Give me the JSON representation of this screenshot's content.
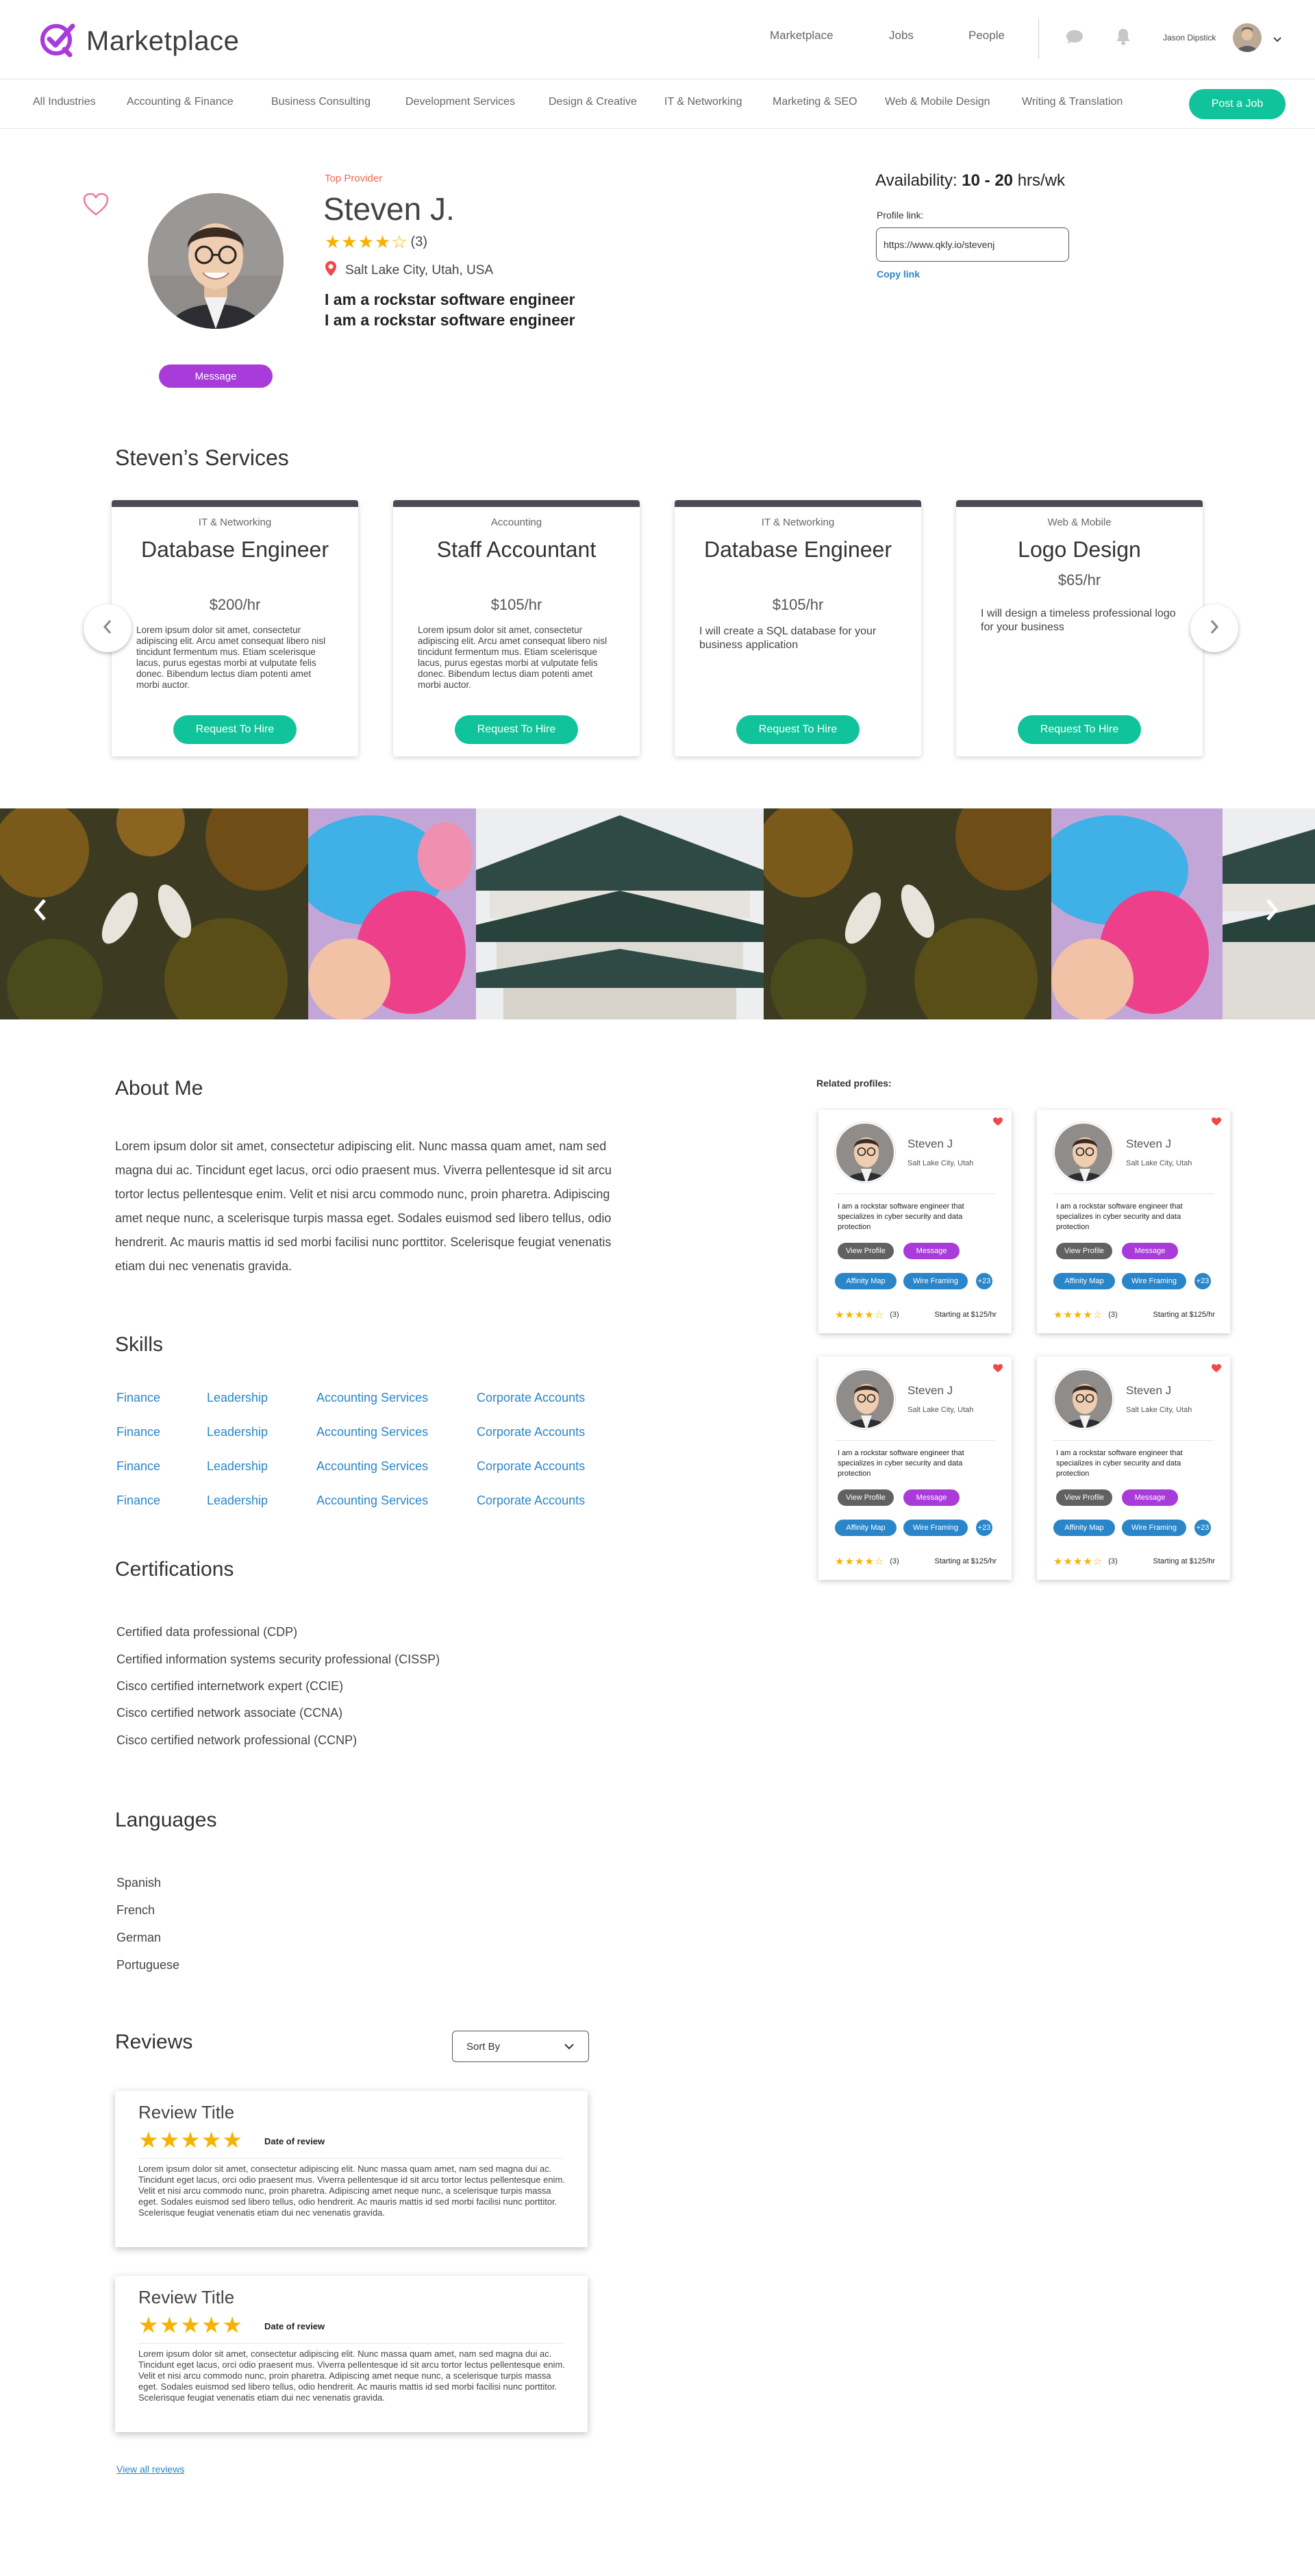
{
  "header": {
    "logo_text": "Marketplace",
    "nav": [
      "Marketplace",
      "Jobs",
      "People"
    ],
    "user_name": "Jason Dipstick"
  },
  "categories": [
    "All Industries",
    "Accounting & Finance",
    "Business Consulting",
    "Development Services",
    "Design & Creative",
    "IT & Networking",
    "Marketing & SEO",
    "Web & Mobile Design",
    "Writing & Translation"
  ],
  "post_job_label": "Post a Job",
  "profile": {
    "badge": "Top Provider",
    "name": "Steven J.",
    "stars": "★★★★☆",
    "rating_count": "(3)",
    "location": "Salt Lake City, Utah, USA",
    "tagline_1": "I am a rockstar software engineer",
    "tagline_2": "I am a rockstar software engineer",
    "message_label": "Message",
    "availability_label": "Availability:",
    "availability_range": "10 - 20",
    "availability_unit": "hrs/wk",
    "profile_link_label": "Profile link:",
    "profile_link_value": "https://www.qkly.io/stevenj",
    "copy_link_label": "Copy link"
  },
  "services": {
    "heading": "Steven’s Services",
    "cards": [
      {
        "category": "IT & Networking",
        "title": "Database Engineer",
        "rate": "$200/hr",
        "desc": "Lorem ipsum dolor sit amet, consectetur adipiscing elit. Arcu amet consequat libero nisl tincidunt fermentum mus. Etiam scelerisque lacus, purus egestas morbi at vulputate felis donec. Bibendum lectus diam potenti amet morbi auctor.",
        "button": "Request To Hire"
      },
      {
        "category": "Accounting",
        "title": "Staff Accountant",
        "rate": "$105/hr",
        "desc": "Lorem ipsum dolor sit amet, consectetur adipiscing elit. Arcu amet consequat libero nisl tincidunt fermentum mus. Etiam scelerisque lacus, purus egestas morbi at vulputate felis donec. Bibendum lectus diam potenti amet morbi auctor.",
        "button": "Request To Hire"
      },
      {
        "category": "IT & Networking",
        "title": "Database Engineer",
        "rate": "$105/hr",
        "desc": "I will create a SQL database for your business application",
        "button": "Request To Hire"
      },
      {
        "category": "Web & Mobile",
        "title": "Logo Design",
        "rate": "$65/hr",
        "desc": "I will design a timeless professional logo for your business",
        "button": "Request To Hire"
      }
    ]
  },
  "about": {
    "heading": "About Me",
    "text": "Lorem ipsum dolor sit amet, consectetur adipiscing elit. Nunc massa quam amet, nam sed magna dui ac. Tincidunt eget lacus, orci odio praesent mus. Viverra pellentesque id sit arcu tortor lectus pellentesque enim. Velit et nisi arcu commodo nunc, proin pharetra. Adipiscing amet neque nunc, a scelerisque turpis massa eget. Sodales euismod sed libero tellus, odio hendrerit. Ac mauris mattis id sed morbi facilisi nunc porttitor. Scelerisque feugiat venenatis etiam dui nec venenatis gravida."
  },
  "skills": {
    "heading": "Skills",
    "rows": [
      [
        "Finance",
        "Leadership",
        "Accounting Services",
        "Corporate Accounts"
      ],
      [
        "Finance",
        "Leadership",
        "Accounting Services",
        "Corporate Accounts"
      ],
      [
        "Finance",
        "Leadership",
        "Accounting Services",
        "Corporate Accounts"
      ],
      [
        "Finance",
        "Leadership",
        "Accounting Services",
        "Corporate Accounts"
      ]
    ]
  },
  "certifications": {
    "heading": "Certifications",
    "items": [
      "Certified data professional (CDP)",
      "Certified information systems security professional (CISSP)",
      "Cisco certified internetwork expert (CCIE)",
      "Cisco certified network associate (CCNA)",
      "Cisco certified network professional (CCNP)"
    ]
  },
  "languages": {
    "heading": "Languages",
    "items": [
      "Spanish",
      "French",
      "German",
      "Portuguese"
    ]
  },
  "reviews": {
    "heading": "Reviews",
    "sort_label": "Sort By",
    "items": [
      {
        "title": "Review Title",
        "stars": "★★★★★",
        "date": "Date of review",
        "body": "Lorem ipsum dolor sit amet, consectetur adipiscing elit. Nunc massa quam amet, nam sed magna dui ac. Tincidunt eget lacus, orci odio praesent mus. Viverra pellentesque id sit arcu tortor lectus pellentesque enim. Velit et nisi arcu commodo nunc, proin pharetra. Adipiscing amet neque nunc, a scelerisque turpis massa eget. Sodales euismod sed libero tellus, odio hendrerit. Ac mauris mattis id sed morbi facilisi nunc porttitor. Scelerisque feugiat venenatis etiam dui nec venenatis gravida."
      },
      {
        "title": "Review Title",
        "stars": "★★★★★",
        "date": "Date of review",
        "body": "Lorem ipsum dolor sit amet, consectetur adipiscing elit. Nunc massa quam amet, nam sed magna dui ac. Tincidunt eget lacus, orci odio praesent mus. Viverra pellentesque id sit arcu tortor lectus pellentesque enim. Velit et nisi arcu commodo nunc, proin pharetra. Adipiscing amet neque nunc, a scelerisque turpis massa eget. Sodales euismod sed libero tellus, odio hendrerit. Ac mauris mattis id sed morbi facilisi nunc porttitor. Scelerisque feugiat venenatis etiam dui nec venenatis gravida."
      }
    ],
    "view_all_label": "View all reviews"
  },
  "related": {
    "label": "Related profiles:",
    "cards": [
      {
        "name": "Steven J",
        "location": "Salt Lake City, Utah",
        "desc": "I am a rockstar software engineer that specializes in cyber security and data protection",
        "view_profile": "View Profile",
        "message": "Message",
        "tag1": "Affinity Map",
        "tag2": "Wire Framing",
        "more": "+23",
        "stars": "★★★★☆",
        "count": "(3)",
        "price": "Starting at $125/hr"
      },
      {
        "name": "Steven J",
        "location": "Salt Lake City, Utah",
        "desc": "I am a rockstar software engineer that specializes in cyber security and data protection",
        "view_profile": "View Profile",
        "message": "Message",
        "tag1": "Affinity Map",
        "tag2": "Wire Framing",
        "more": "+23",
        "stars": "★★★★☆",
        "count": "(3)",
        "price": "Starting at $125/hr"
      },
      {
        "name": "Steven J",
        "location": "Salt Lake City, Utah",
        "desc": "I am a rockstar software engineer that specializes in cyber security and data protection",
        "view_profile": "View Profile",
        "message": "Message",
        "tag1": "Affinity Map",
        "tag2": "Wire Framing",
        "more": "+23",
        "stars": "★★★★☆",
        "count": "(3)",
        "price": "Starting at $125/hr"
      },
      {
        "name": "Steven J",
        "location": "Salt Lake City, Utah",
        "desc": "I am a rockstar software engineer that specializes in cyber security and data protection",
        "view_profile": "View Profile",
        "message": "Message",
        "tag1": "Affinity Map",
        "tag2": "Wire Framing",
        "more": "+23",
        "stars": "★★★★☆",
        "count": "(3)",
        "price": "Starting at $125/hr"
      }
    ]
  },
  "colors": {
    "accent_green": "#10c39a",
    "accent_purple": "#a83bd9",
    "link_blue": "#2a86c9",
    "star_gold": "#f5b301",
    "heart_red": "#f04848"
  },
  "icons": [
    "logo-check-icon",
    "chat-icon",
    "bell-icon",
    "chevron-down-icon",
    "heart-outline-icon",
    "location-pin-icon",
    "chevron-left-icon",
    "chevron-right-icon",
    "heart-filled-icon"
  ]
}
